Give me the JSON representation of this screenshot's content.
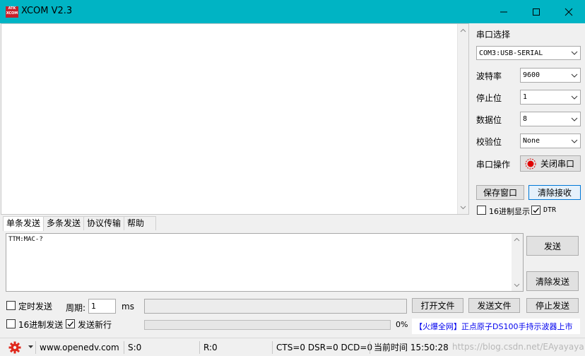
{
  "window": {
    "title": "XCOM V2.3",
    "logo_text": "ATK XCOM",
    "accent_color": "#00b4c4"
  },
  "serial": {
    "section_label": "串口选择",
    "port_value": "COM3:USB-SERIAL",
    "baud_label": "波特率",
    "baud_value": "9600",
    "stopbits_label": "停止位",
    "stopbits_value": "1",
    "databits_label": "数据位",
    "databits_value": "8",
    "parity_label": "校验位",
    "parity_value": "None",
    "operation_label": "串口操作",
    "close_port_label": "关闭串口"
  },
  "receive": {
    "save_window_label": "保存窗口",
    "clear_receive_label": "清除接收",
    "hex_display_label": "16进制显示",
    "hex_display_checked": false,
    "dtr_label": "DTR",
    "dtr_checked": true
  },
  "tabs": [
    "单条发送",
    "多条发送",
    "协议传输",
    "帮助"
  ],
  "send": {
    "text": "TTM:MAC-?",
    "send_label": "发送",
    "clear_send_label": "清除发送",
    "timed_send_label": "定时发送",
    "timed_send_checked": false,
    "period_label": "周期:",
    "period_value": "1",
    "period_unit": "ms",
    "open_file_label": "打开文件",
    "send_file_label": "发送文件",
    "stop_send_label": "停止发送",
    "hex_send_label": "16进制发送",
    "hex_send_checked": false,
    "newline_label": "发送新行",
    "newline_checked": true,
    "progress_percent": 0,
    "progress_text": "0%"
  },
  "ad": {
    "text": "【火爆全网】正点原子DS100手持示波器上市"
  },
  "status": {
    "website": "www.openedv.com",
    "sent": "S:0",
    "received": "R:0",
    "lines": "CTS=0 DSR=0 DCD=0",
    "time": "当前时间 15:50:28",
    "watermark": "https://blog.csdn.net/EAyayaya"
  }
}
